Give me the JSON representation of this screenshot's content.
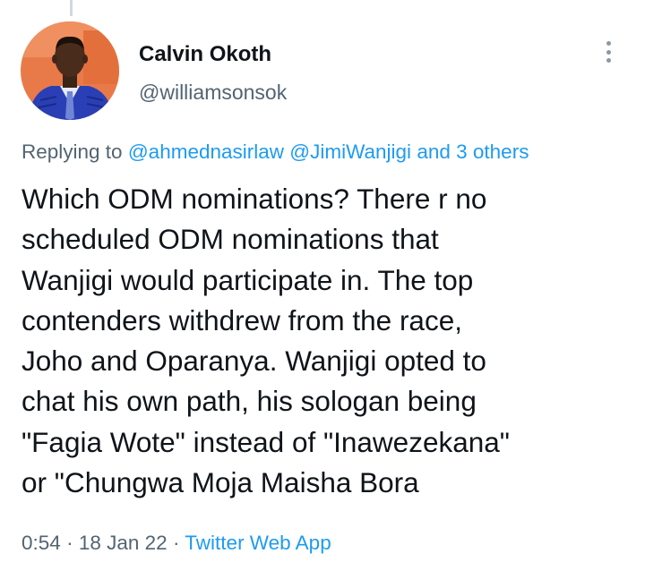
{
  "author": {
    "display_name": "Calvin Okoth",
    "handle": "@williamsonsok",
    "avatar_icon": "profile-photo"
  },
  "reply": {
    "prefix": "Replying to",
    "mention_1": "@ahmednasirlaw",
    "mention_2": "@JimiWanjigi",
    "connector": "and",
    "others": "3 others"
  },
  "tweet": {
    "text": "Which ODM nominations? There r no\nscheduled ODM nominations that\nWanjigi would participate in. The top\ncontenders withdrew from the race,\nJoho and Oparanya. Wanjigi opted to\nchat his own path, his sologan being\n\"Fagia Wote\" instead of \"Inawezekana\"\nor \"Chungwa Moja Maisha Bora"
  },
  "meta": {
    "time": "0:54",
    "separator": "·",
    "date": "18 Jan 22",
    "source": "Twitter Web App"
  },
  "more_icon": "more-vertical-icon",
  "colors": {
    "text": "#0f1419",
    "secondary": "#536471",
    "link": "#1d9bf0"
  }
}
